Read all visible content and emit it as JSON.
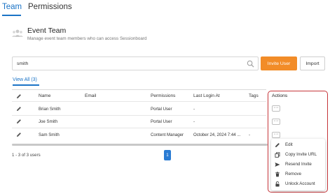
{
  "tabs": [
    {
      "label": "Team",
      "active": true
    },
    {
      "label": "Permissions",
      "active": false
    }
  ],
  "header": {
    "icon": "team-icon",
    "title": "Event Team",
    "subtitle": "Manage event team members who can access Sessionboard"
  },
  "search": {
    "value": "smith",
    "icon": "search-icon"
  },
  "buttons": {
    "invite": "Invite User",
    "import": "Import"
  },
  "filter": {
    "view_all": "View All (3)"
  },
  "table": {
    "columns": [
      "Name",
      "Email",
      "Permissions",
      "Last Login At",
      "Tags",
      "Actions"
    ],
    "rows": [
      {
        "name": "Brian Smith",
        "email": "",
        "permissions": "Portal User",
        "last_login": "-",
        "tags": ""
      },
      {
        "name": "Joe Smith",
        "email": "",
        "permissions": "Portal User",
        "last_login": "-",
        "tags": ""
      },
      {
        "name": "Sam Smith",
        "email": "",
        "permissions": "Content Manager",
        "last_login": "October 24, 2024 7:44 ...",
        "tags": "-"
      }
    ],
    "more_label": "···"
  },
  "action_menu": [
    {
      "label": "Edit",
      "icon": "pencil-icon"
    },
    {
      "label": "Copy Invite URL",
      "icon": "copy-icon"
    },
    {
      "label": "Resend Invite",
      "icon": "send-icon"
    },
    {
      "label": "Remove",
      "icon": "trash-icon"
    },
    {
      "label": "Unlock Account",
      "icon": "lock-icon"
    }
  ],
  "pagination": {
    "info": "1 - 3 of 3 users",
    "current_page": "1"
  },
  "colors": {
    "accent": "#1a73c6",
    "invite_button": "#f28c28",
    "highlight_box": "#c6353a",
    "page_button": "#2a7bd3"
  }
}
